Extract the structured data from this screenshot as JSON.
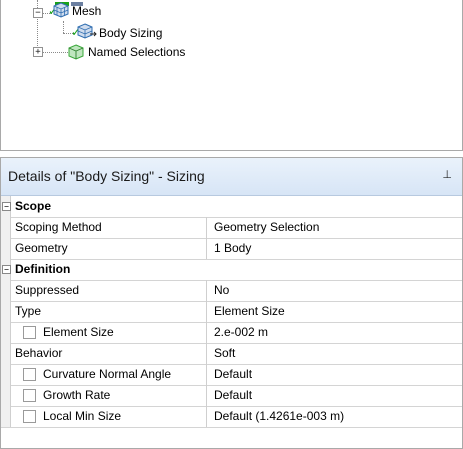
{
  "tree": {
    "nodes": [
      {
        "id": "mesh",
        "label": "Mesh",
        "expander": "−"
      },
      {
        "id": "body-sizing",
        "label": "Body Sizing"
      },
      {
        "id": "named-selections",
        "label": "Named Selections",
        "expander": "+"
      }
    ]
  },
  "details": {
    "title": "Details of \"Body Sizing\" - Sizing",
    "pin_glyph": "⊥",
    "categories": {
      "scope": {
        "label": "Scope",
        "expander": "−"
      },
      "definition": {
        "label": "Definition",
        "expander": "−"
      }
    },
    "rows": {
      "scoping_method": {
        "label": "Scoping Method",
        "value": "Geometry Selection"
      },
      "geometry": {
        "label": "Geometry",
        "value": "1 Body"
      },
      "suppressed": {
        "label": "Suppressed",
        "value": "No"
      },
      "type": {
        "label": "Type",
        "value": "Element Size"
      },
      "element_size": {
        "label": "Element Size",
        "value": "2.e-002 m"
      },
      "behavior": {
        "label": "Behavior",
        "value": "Soft"
      },
      "curvature_normal_angle": {
        "label": "Curvature Normal Angle",
        "value": "Default"
      },
      "growth_rate": {
        "label": "Growth Rate",
        "value": "Default"
      },
      "local_min_size": {
        "label": "Local Min Size",
        "value": "Default (1.4261e-003 m)"
      }
    }
  },
  "colors": {
    "check": "#19a119",
    "mesh_icon": "#2f6db0",
    "named_sel_icon": "#3aa83a",
    "header_bg": "#dbe7f6"
  }
}
